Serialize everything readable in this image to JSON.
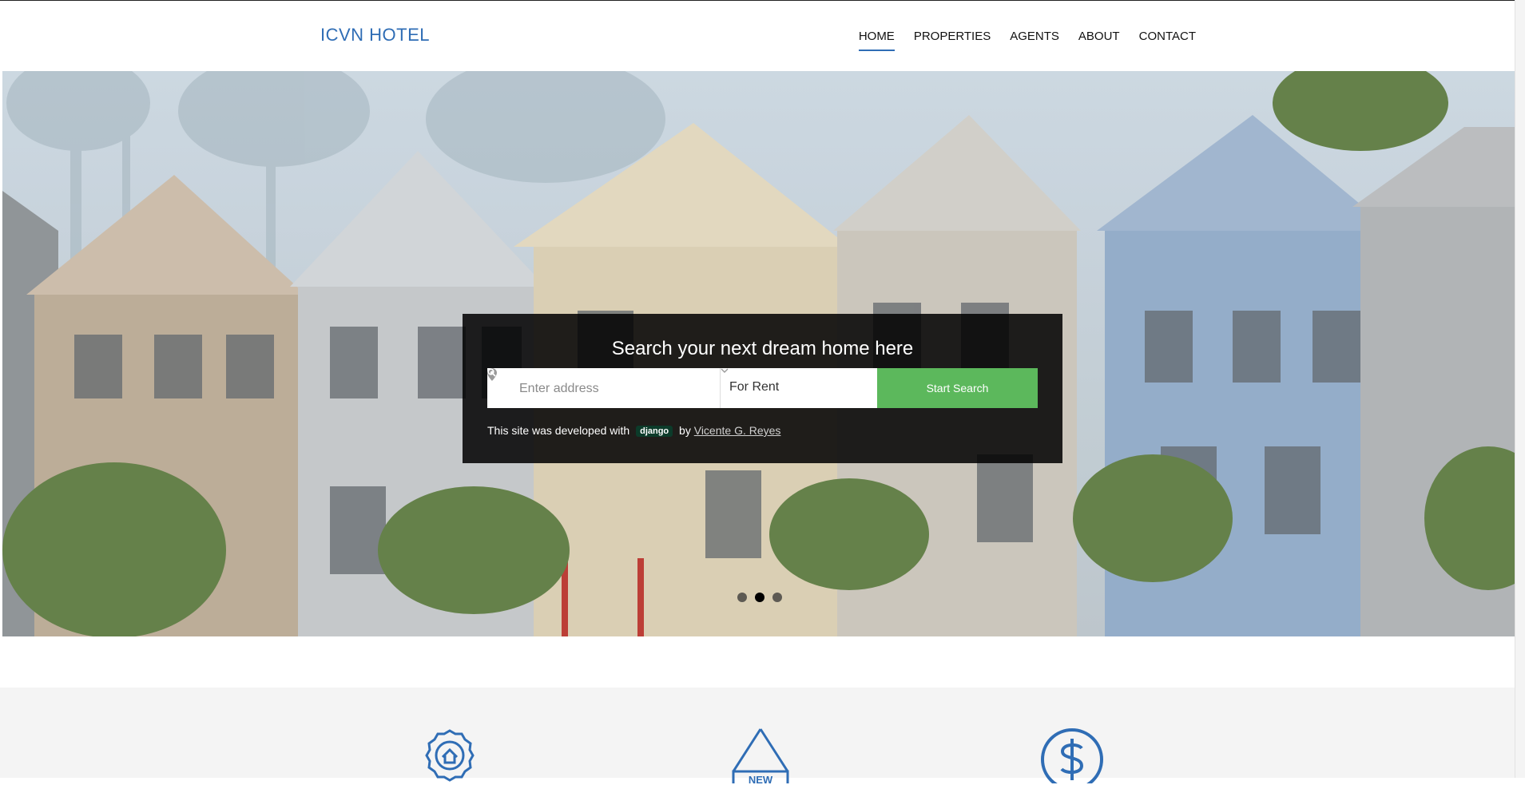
{
  "header": {
    "brand": "ICVN HOTEL",
    "nav": [
      {
        "label": "HOME",
        "active": true
      },
      {
        "label": "PROPERTIES",
        "active": false
      },
      {
        "label": "AGENTS",
        "active": false
      },
      {
        "label": "ABOUT",
        "active": false
      },
      {
        "label": "CONTACT",
        "active": false
      }
    ]
  },
  "hero": {
    "search_title": "Search your next dream home here",
    "address_placeholder": "Enter address",
    "type_select_value": "For Rent",
    "search_button": "Start Search",
    "credit_prefix": "This site was developed with",
    "credit_badge": "django",
    "credit_by": "by",
    "credit_author": "Vicente G. Reyes",
    "carousel": {
      "slides": 3,
      "active_index": 1
    }
  },
  "features": {
    "icons": [
      "award-house-icon",
      "new-tag-icon",
      "dollar-circle-icon"
    ]
  },
  "colors": {
    "brand": "#2f6db5",
    "search_button": "#5cb85c",
    "panel": "#000000",
    "features_bg": "#f4f4f4"
  }
}
